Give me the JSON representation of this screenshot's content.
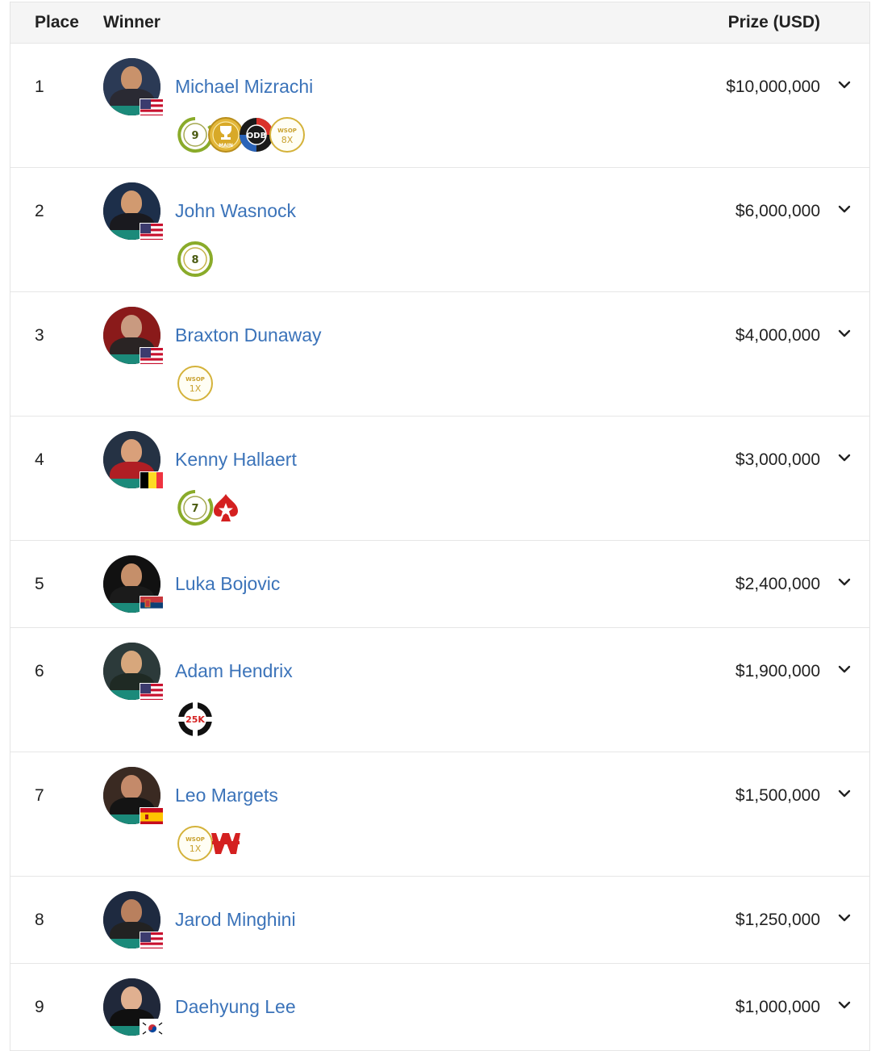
{
  "header": {
    "place": "Place",
    "winner": "Winner",
    "prize": "Prize (USD)"
  },
  "rows": [
    {
      "place": "1",
      "name": "Michael Mizrachi",
      "prize": "$10,000,000",
      "flag": "us",
      "badges": [
        {
          "type": "bracelet",
          "text": "9"
        },
        {
          "type": "main",
          "text": "MAIN"
        },
        {
          "type": "odb",
          "text": "ODB"
        },
        {
          "type": "wsop",
          "text": "8X"
        }
      ]
    },
    {
      "place": "2",
      "name": "John Wasnock",
      "prize": "$6,000,000",
      "flag": "us",
      "badges": [
        {
          "type": "bracelet-full",
          "text": "8"
        }
      ]
    },
    {
      "place": "3",
      "name": "Braxton Dunaway",
      "prize": "$4,000,000",
      "flag": "us",
      "badges": [
        {
          "type": "wsop",
          "text": "1X"
        }
      ]
    },
    {
      "place": "4",
      "name": "Kenny Hallaert",
      "prize": "$3,000,000",
      "flag": "be",
      "badges": [
        {
          "type": "bracelet",
          "text": "7"
        },
        {
          "type": "pokerstars",
          "text": ""
        }
      ]
    },
    {
      "place": "5",
      "name": "Luka Bojovic",
      "prize": "$2,400,000",
      "flag": "rs",
      "badges": []
    },
    {
      "place": "6",
      "name": "Adam Hendrix",
      "prize": "$1,900,000",
      "flag": "us",
      "badges": [
        {
          "type": "chip25k",
          "text": "25K"
        }
      ]
    },
    {
      "place": "7",
      "name": "Leo Margets",
      "prize": "$1,500,000",
      "flag": "es",
      "badges": [
        {
          "type": "wsop",
          "text": "1X"
        },
        {
          "type": "pokerstars-w",
          "text": ""
        }
      ]
    },
    {
      "place": "8",
      "name": "Jarod Minghini",
      "prize": "$1,250,000",
      "flag": "us",
      "badges": []
    },
    {
      "place": "9",
      "name": "Daehyung Lee",
      "prize": "$1,000,000",
      "flag": "kr",
      "badges": []
    }
  ],
  "icons": {
    "expand": "chevron-down-icon"
  },
  "colors": {
    "link": "#3b73b9",
    "bracelet_green": "#7a9a1e",
    "bracelet_gold": "#d4b23a",
    "header_bg": "#f5f5f5"
  }
}
